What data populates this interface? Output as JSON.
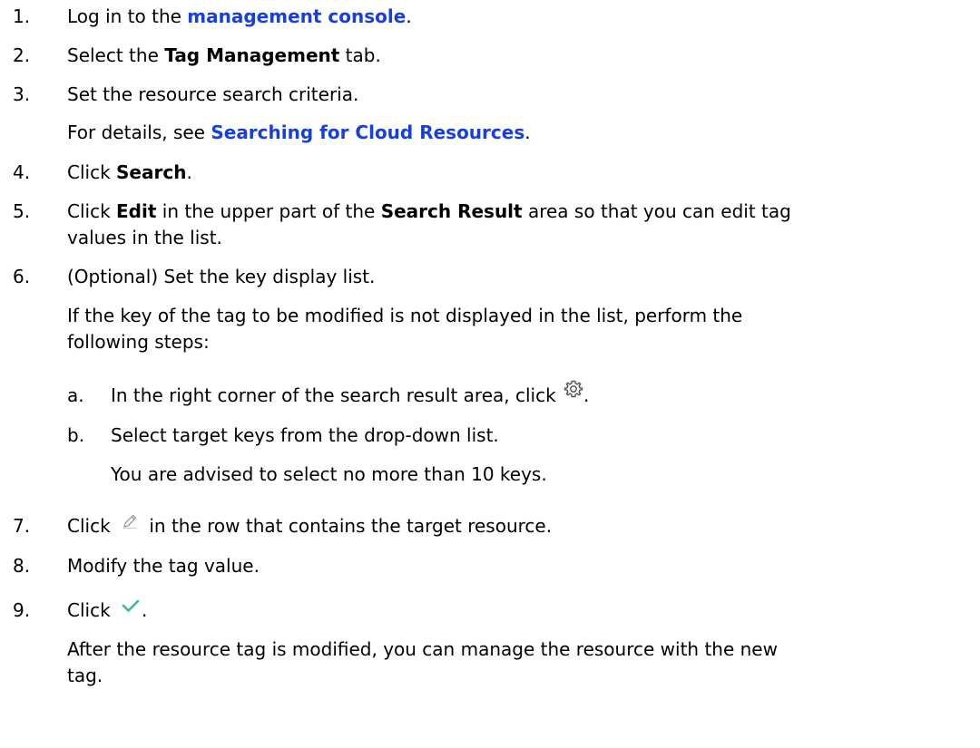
{
  "steps": {
    "s1": {
      "num": "1.",
      "pre": "Log in to the ",
      "link": "management console",
      "post": "."
    },
    "s2": {
      "num": "2.",
      "pre": "Select the ",
      "bold": "Tag Management",
      "post": " tab."
    },
    "s3": {
      "num": "3.",
      "text": "Set the resource search criteria.",
      "note_pre": "For details, see ",
      "note_link": "Searching for Cloud Resources",
      "note_post": "."
    },
    "s4": {
      "num": "4.",
      "pre": "Click ",
      "bold": "Search",
      "post": "."
    },
    "s5": {
      "num": "5.",
      "pre": "Click ",
      "bold1": "Edit",
      "mid": " in the upper part of the ",
      "bold2": "Search Result",
      "post": " area so that you can edit tag",
      "line2": "values in the list."
    },
    "s6": {
      "num": "6.",
      "text": "(Optional) Set the key display list.",
      "note_l1": "If the key of the tag to be modified is not displayed in the list, perform the",
      "note_l2": "following steps:",
      "sub": [
        {
          "num": "a.",
          "pre": "In the right corner of the search result area, click ",
          "icon": "gear-icon",
          "post": "."
        },
        {
          "num": "b.",
          "text": "Select target keys from the drop-down list.",
          "note": "You are advised to select no more than 10 keys."
        }
      ]
    },
    "s7": {
      "num": "7.",
      "pre": "Click ",
      "icon": "pencil-edit-icon",
      "post": " in the row that contains the target resource."
    },
    "s8": {
      "num": "8.",
      "text": "Modify the tag value."
    },
    "s9": {
      "num": "9.",
      "pre": "Click ",
      "icon": "checkmark-icon",
      "post": ".",
      "note_l1": "After the resource tag is modified, you can manage the resource with the new",
      "note_l2": "tag."
    }
  },
  "colors": {
    "link": "#1a3fd6",
    "check": "#2fc08e",
    "gear": "#555555",
    "pencil": "#9a9a9a"
  }
}
